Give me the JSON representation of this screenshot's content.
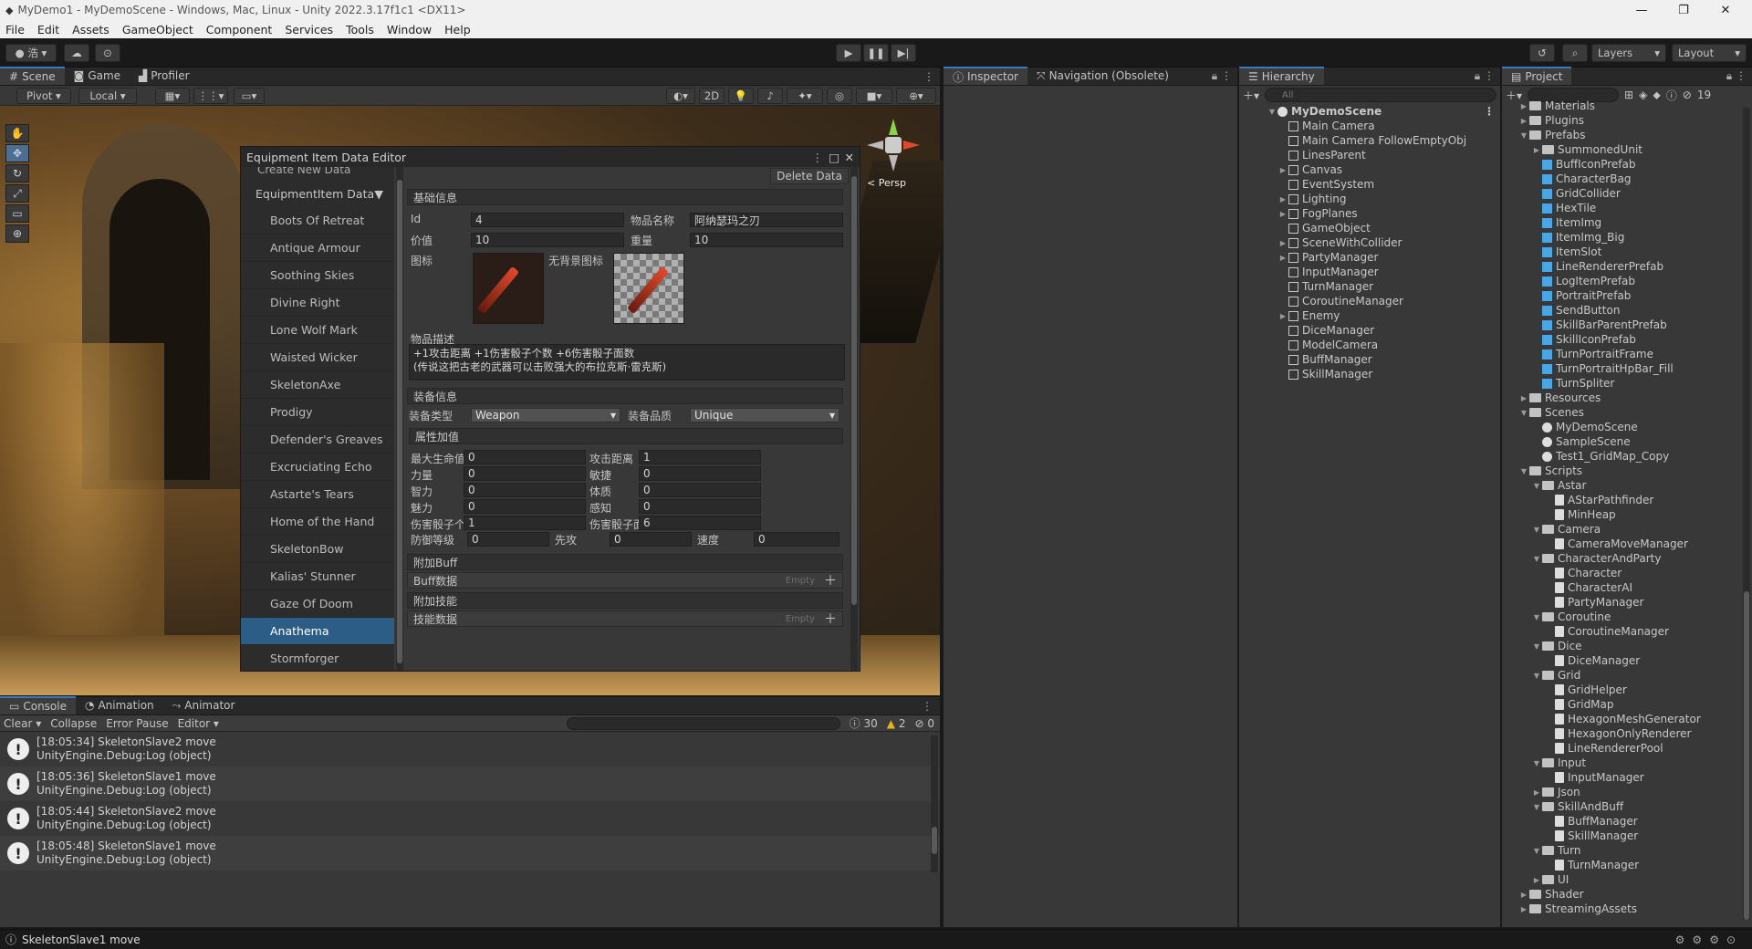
{
  "window": {
    "title": "MyDemo1 - MyDemoScene - Windows, Mac, Linux - Unity 2022.3.17f1c1 <DX11>",
    "controls": [
      "—",
      "❐",
      "✕"
    ]
  },
  "menu": [
    "File",
    "Edit",
    "Assets",
    "GameObject",
    "Component",
    "Services",
    "Tools",
    "Window",
    "Help"
  ],
  "toolbar": {
    "account": "浩",
    "layers": "Layers",
    "layout": "Layout"
  },
  "scene_tabs": [
    "Scene",
    "Game",
    "Profiler"
  ],
  "scene_toolbar": {
    "pivot": "Pivot",
    "local": "Local",
    "mode2d": "2D",
    "persp": "< Persp"
  },
  "editor": {
    "title": "Equipment Item Data Editor",
    "create_label": "Create New Data",
    "category": "EquipmentItem Data",
    "items": [
      "Boots Of Retreat",
      "Antique Armour",
      "Soothing Skies",
      "Divine Right",
      "Lone Wolf Mark",
      "Waisted Wicker",
      "SkeletonAxe",
      "Prodigy",
      "Defender's Greaves",
      "Excruciating Echo",
      "Astarte's Tears",
      "Home of the Hand",
      "SkeletonBow",
      "Kalias' Stunner",
      "Gaze Of Doom",
      "Anathema",
      "Stormforger"
    ],
    "selected_index": 15,
    "delete": "Delete Data",
    "basic_section": "基础信息",
    "id_label": "Id",
    "id_value": "4",
    "name_label": "物品名称",
    "name_value": "阿纳瑟玛之刃",
    "price_label": "价值",
    "price_value": "10",
    "weight_label": "重量",
    "weight_value": "10",
    "icon_label": "图标",
    "noback_icon_label": "无背景图标",
    "desc_label": "物品描述",
    "desc_line1": "+1攻击距离 +1伤害骰子个数 +6伤害骰子面数",
    "desc_line2": "(传说这把古老的武器可以击败强大的布拉克斯·雷克斯)",
    "equip_section": "装备信息",
    "type_label": "装备类型",
    "type_value": "Weapon",
    "quality_label": "装备品质",
    "quality_value": "Unique",
    "attr_section": "属性加值",
    "attrs": [
      {
        "l1": "最大生命值",
        "v1": "0",
        "l2": "攻击距离",
        "v2": "1"
      },
      {
        "l1": "力量",
        "v1": "0",
        "l2": "敏捷",
        "v2": "0"
      },
      {
        "l1": "智力",
        "v1": "0",
        "l2": "体质",
        "v2": "0"
      },
      {
        "l1": "魅力",
        "v1": "0",
        "l2": "感知",
        "v2": "0"
      },
      {
        "l1": "伤害骰子个数",
        "v1": "1",
        "l2": "伤害骰子面数",
        "v2": "6"
      }
    ],
    "def_label": "防御等级",
    "def_value": "0",
    "init_label": "先攻",
    "init_value": "0",
    "speed_label": "速度",
    "speed_value": "0",
    "buff_section": "附加Buff",
    "buff_label": "Buff数据",
    "buff_empty": "Empty",
    "skill_section": "附加技能",
    "skill_label": "技能数据",
    "skill_empty": "Empty"
  },
  "inspector_tabs": [
    "Inspector",
    "Navigation (Obsolete)"
  ],
  "hierarchy": {
    "tab": "Hierarchy",
    "search": "All",
    "scene": "MyDemoScene",
    "items": [
      {
        "t": "Main Camera",
        "a": ""
      },
      {
        "t": "Main Camera FollowEmptyObj",
        "a": ""
      },
      {
        "t": "LinesParent",
        "a": ""
      },
      {
        "t": "Canvas",
        "a": "▶"
      },
      {
        "t": "EventSystem",
        "a": ""
      },
      {
        "t": "Lighting",
        "a": "▶"
      },
      {
        "t": "FogPlanes",
        "a": "▶"
      },
      {
        "t": "GameObject",
        "a": ""
      },
      {
        "t": "SceneWithCollider",
        "a": "▶"
      },
      {
        "t": "PartyManager",
        "a": "▶"
      },
      {
        "t": "InputManager",
        "a": ""
      },
      {
        "t": "TurnManager",
        "a": ""
      },
      {
        "t": "CoroutineManager",
        "a": ""
      },
      {
        "t": "Enemy",
        "a": "▶"
      },
      {
        "t": "DiceManager",
        "a": ""
      },
      {
        "t": "ModelCamera",
        "a": ""
      },
      {
        "t": "BuffManager",
        "a": ""
      },
      {
        "t": "SkillManager",
        "a": ""
      }
    ]
  },
  "project": {
    "tab": "Project",
    "badge": "19",
    "items": [
      {
        "t": "Materials",
        "k": "folder",
        "d": 1,
        "a": "▶"
      },
      {
        "t": "Plugins",
        "k": "folder",
        "d": 1,
        "a": "▶"
      },
      {
        "t": "Prefabs",
        "k": "folder",
        "d": 1,
        "a": "▼"
      },
      {
        "t": "SummonedUnit",
        "k": "folder",
        "d": 2,
        "a": "▶"
      },
      {
        "t": "BuffIconPrefab",
        "k": "prefab",
        "d": 2,
        "a": ""
      },
      {
        "t": "CharacterBag",
        "k": "prefab",
        "d": 2,
        "a": ""
      },
      {
        "t": "GridCollider",
        "k": "prefab",
        "d": 2,
        "a": ""
      },
      {
        "t": "HexTile",
        "k": "prefab",
        "d": 2,
        "a": ""
      },
      {
        "t": "ItemImg",
        "k": "prefab",
        "d": 2,
        "a": ""
      },
      {
        "t": "ItemImg_Big",
        "k": "prefab",
        "d": 2,
        "a": ""
      },
      {
        "t": "ItemSlot",
        "k": "prefab",
        "d": 2,
        "a": ""
      },
      {
        "t": "LineRendererPrefab",
        "k": "prefab",
        "d": 2,
        "a": ""
      },
      {
        "t": "LogItemPrefab",
        "k": "prefab",
        "d": 2,
        "a": ""
      },
      {
        "t": "PortraitPrefab",
        "k": "prefab",
        "d": 2,
        "a": ""
      },
      {
        "t": "SendButton",
        "k": "prefab",
        "d": 2,
        "a": ""
      },
      {
        "t": "SkillBarParentPrefab",
        "k": "prefab",
        "d": 2,
        "a": ""
      },
      {
        "t": "SkillIconPrefab",
        "k": "prefab",
        "d": 2,
        "a": ""
      },
      {
        "t": "TurnPortraitFrame",
        "k": "prefab",
        "d": 2,
        "a": ""
      },
      {
        "t": "TurnPortraitHpBar_Fill",
        "k": "prefab",
        "d": 2,
        "a": ""
      },
      {
        "t": "TurnSpliter",
        "k": "prefab",
        "d": 2,
        "a": ""
      },
      {
        "t": "Resources",
        "k": "folder",
        "d": 1,
        "a": "▶"
      },
      {
        "t": "Scenes",
        "k": "folder",
        "d": 1,
        "a": "▼"
      },
      {
        "t": "MyDemoScene",
        "k": "scene",
        "d": 2,
        "a": ""
      },
      {
        "t": "SampleScene",
        "k": "scene",
        "d": 2,
        "a": ""
      },
      {
        "t": "Test1_GridMap_Copy",
        "k": "scene",
        "d": 2,
        "a": ""
      },
      {
        "t": "Scripts",
        "k": "folder",
        "d": 1,
        "a": "▼"
      },
      {
        "t": "Astar",
        "k": "folder",
        "d": 2,
        "a": "▼"
      },
      {
        "t": "AStarPathfinder",
        "k": "script",
        "d": 3,
        "a": ""
      },
      {
        "t": "MinHeap",
        "k": "script",
        "d": 3,
        "a": ""
      },
      {
        "t": "Camera",
        "k": "folder",
        "d": 2,
        "a": "▼"
      },
      {
        "t": "CameraMoveManager",
        "k": "script",
        "d": 3,
        "a": ""
      },
      {
        "t": "CharacterAndParty",
        "k": "folder",
        "d": 2,
        "a": "▼"
      },
      {
        "t": "Character",
        "k": "script",
        "d": 3,
        "a": ""
      },
      {
        "t": "CharacterAI",
        "k": "script",
        "d": 3,
        "a": ""
      },
      {
        "t": "PartyManager",
        "k": "script",
        "d": 3,
        "a": ""
      },
      {
        "t": "Coroutine",
        "k": "folder",
        "d": 2,
        "a": "▼"
      },
      {
        "t": "CoroutineManager",
        "k": "script",
        "d": 3,
        "a": ""
      },
      {
        "t": "Dice",
        "k": "folder",
        "d": 2,
        "a": "▼"
      },
      {
        "t": "DiceManager",
        "k": "script",
        "d": 3,
        "a": ""
      },
      {
        "t": "Grid",
        "k": "folder",
        "d": 2,
        "a": "▼"
      },
      {
        "t": "GridHelper",
        "k": "script",
        "d": 3,
        "a": ""
      },
      {
        "t": "GridMap",
        "k": "script",
        "d": 3,
        "a": ""
      },
      {
        "t": "HexagonMeshGenerator",
        "k": "script",
        "d": 3,
        "a": ""
      },
      {
        "t": "HexagonOnlyRenderer",
        "k": "script",
        "d": 3,
        "a": ""
      },
      {
        "t": "LineRendererPool",
        "k": "script",
        "d": 3,
        "a": ""
      },
      {
        "t": "Input",
        "k": "folder",
        "d": 2,
        "a": "▼"
      },
      {
        "t": "InputManager",
        "k": "script",
        "d": 3,
        "a": ""
      },
      {
        "t": "Json",
        "k": "folder",
        "d": 2,
        "a": "▶"
      },
      {
        "t": "SkillAndBuff",
        "k": "folder",
        "d": 2,
        "a": "▼"
      },
      {
        "t": "BuffManager",
        "k": "script",
        "d": 3,
        "a": ""
      },
      {
        "t": "SkillManager",
        "k": "script",
        "d": 3,
        "a": ""
      },
      {
        "t": "Turn",
        "k": "folder",
        "d": 2,
        "a": "▼"
      },
      {
        "t": "TurnManager",
        "k": "script",
        "d": 3,
        "a": ""
      },
      {
        "t": "UI",
        "k": "folder",
        "d": 2,
        "a": "▶"
      },
      {
        "t": "Shader",
        "k": "folder",
        "d": 1,
        "a": "▶"
      },
      {
        "t": "StreamingAssets",
        "k": "folder",
        "d": 1,
        "a": "▶"
      }
    ]
  },
  "console": {
    "tabs": [
      "Console",
      "Animation",
      "Animator"
    ],
    "buttons": {
      "clear": "Clear",
      "collapse": "Collapse",
      "error_pause": "Error Pause",
      "editor": "Editor"
    },
    "counts": {
      "info": "30",
      "warn": "2",
      "error": "0"
    },
    "logs": [
      {
        "l1": "[18:05:34] SkeletonSlave2 move",
        "l2": "UnityEngine.Debug:Log (object)"
      },
      {
        "l1": "[18:05:36] SkeletonSlave1 move",
        "l2": "UnityEngine.Debug:Log (object)"
      },
      {
        "l1": "[18:05:44] SkeletonSlave2 move",
        "l2": "UnityEngine.Debug:Log (object)"
      },
      {
        "l1": "[18:05:48] SkeletonSlave1 move",
        "l2": "UnityEngine.Debug:Log (object)"
      }
    ]
  },
  "status": {
    "message": "SkeletonSlave1 move"
  }
}
